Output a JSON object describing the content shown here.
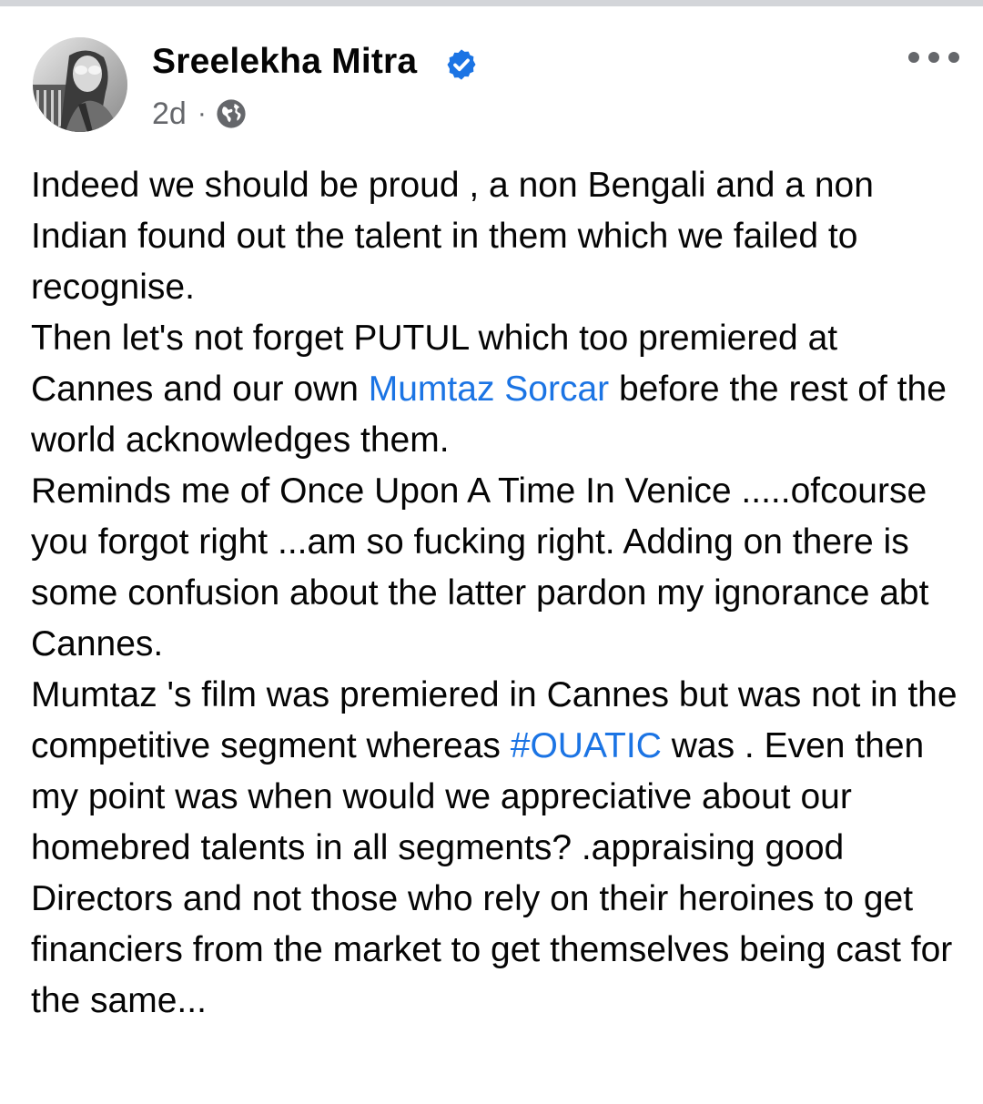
{
  "post": {
    "author": "Sreelekha Mitra",
    "timestamp": "2d",
    "separator": "·",
    "privacy_icon": "globe-icon",
    "verified_icon": "verified-badge-icon",
    "more_icon": "more-options-icon",
    "link_color": "#1b74e4",
    "meta_color": "#65676b",
    "paragraphs": [
      {
        "text": "Indeed we should be proud , a non Bengali and a non Indian found out the talent in them which we failed to recognise."
      },
      {
        "before": "Then let's not forget PUTUL which too premiered at Cannes and our own ",
        "link": "Mumtaz Sorcar",
        "after": " before the rest of the world acknowledges them."
      },
      {
        "text": "Reminds me of Once Upon A Time In Venice .....ofcourse you forgot right ...am so fucking right. Adding on there is some confusion about the latter pardon my ignorance abt Cannes."
      },
      {
        "before": "Mumtaz 's film was premiered in Cannes but was not in the competitive segment whereas ",
        "link": "#OUATIC",
        "after": " was . Even then my point was when would we appreciative about our homebred talents in all segments? .appraising good Directors and not those who rely on their heroines to get financiers from the market to get themselves being cast for the same..."
      }
    ]
  }
}
